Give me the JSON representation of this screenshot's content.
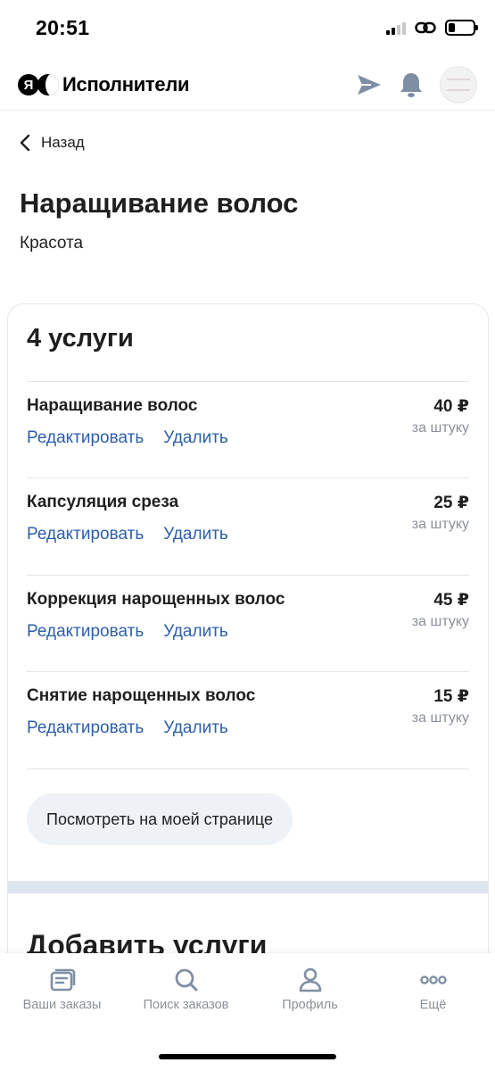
{
  "status_bar": {
    "time": "20:51"
  },
  "header": {
    "app_name": "Исполнители"
  },
  "nav": {
    "back_label": "Назад"
  },
  "page": {
    "title": "Наращивание волос",
    "subtitle": "Красота"
  },
  "services_card": {
    "title": "4 услуги",
    "edit_label": "Редактировать",
    "delete_label": "Удалить",
    "items": [
      {
        "name": "Наращивание волос",
        "price": "40 ₽",
        "unit": "за штуку"
      },
      {
        "name": "Капсуляция среза",
        "price": "25 ₽",
        "unit": "за штуку"
      },
      {
        "name": "Коррекция нарощенных волос",
        "price": "45 ₽",
        "unit": "за штуку"
      },
      {
        "name": "Снятие нарощенных волос",
        "price": "15 ₽",
        "unit": "за штуку"
      }
    ],
    "view_button": "Посмотреть на моей странице",
    "add_title": "Добавить услуги"
  },
  "bottom_nav": {
    "items": [
      {
        "label": "Ваши заказы",
        "icon": "orders-icon"
      },
      {
        "label": "Поиск заказов",
        "icon": "search-icon"
      },
      {
        "label": "Профиль",
        "icon": "profile-icon"
      },
      {
        "label": "Ещё",
        "icon": "more-icon"
      }
    ]
  },
  "colors": {
    "link": "#2d5fa8",
    "muted": "#8a919a",
    "icon": "#7f8fa3"
  }
}
